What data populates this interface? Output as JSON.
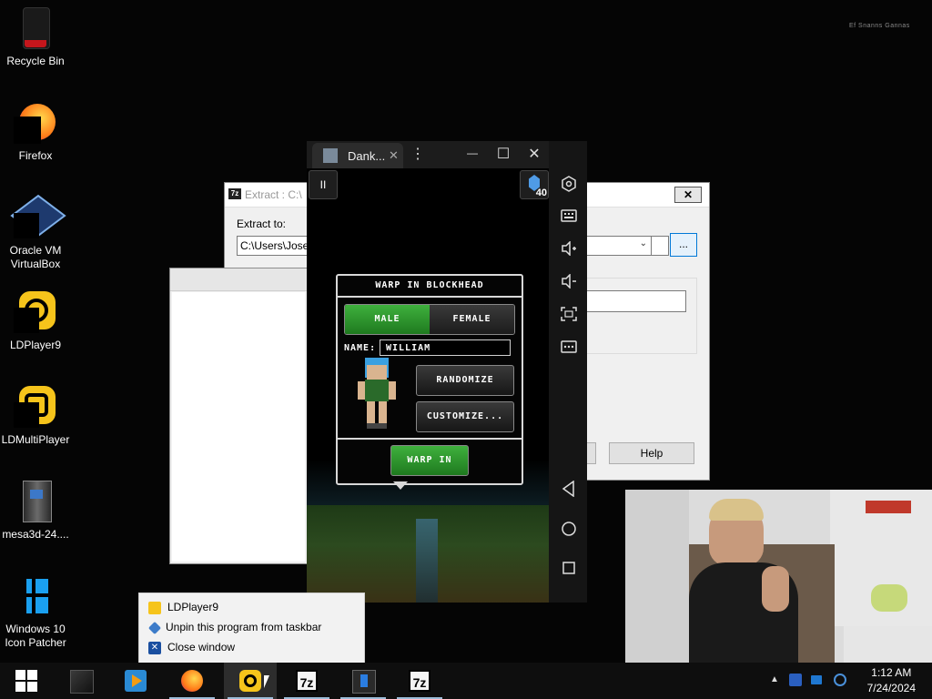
{
  "desktop": {
    "icons": [
      {
        "label": "Recycle Bin"
      },
      {
        "label": "Firefox"
      },
      {
        "label": "Oracle VM VirtualBox"
      },
      {
        "label": "LDPlayer9"
      },
      {
        "label": "LDMultiPlayer"
      },
      {
        "label": "mesa3d-24...."
      },
      {
        "label": "Windows 10 Icon Patcher"
      }
    ]
  },
  "extract_window": {
    "title": "Extract : C:\\",
    "extract_to_label": "Extract to:",
    "path_value": "C:\\Users\\Josep",
    "browse_label": "...",
    "close_label": "✕",
    "help_label": "Help"
  },
  "ldplayer": {
    "tab_title": "Dank...",
    "tab_close": "✕",
    "menu_glyph": "⋮",
    "minimize": "—",
    "maximize": "☐",
    "close": "✕",
    "collapse": "«",
    "gem_count": "40",
    "pause_glyph": "II"
  },
  "game_dialog": {
    "title": "WARP IN BLOCKHEAD",
    "male": "MALE",
    "female": "FEMALE",
    "name_label": "NAME:",
    "name_value": "WILLIAM",
    "randomize": "RANDOMIZE",
    "customize": "CUSTOMIZE...",
    "warp_in": "WARP IN"
  },
  "jump_list": {
    "items": [
      {
        "label": "LDPlayer9"
      },
      {
        "label": "Unpin this program from taskbar"
      },
      {
        "label": "Close window"
      }
    ]
  },
  "taskbar": {
    "time": "1:12 AM",
    "date": "7/24/2024",
    "seven_zip_label": "7z",
    "overflow_glyph": "▲"
  }
}
